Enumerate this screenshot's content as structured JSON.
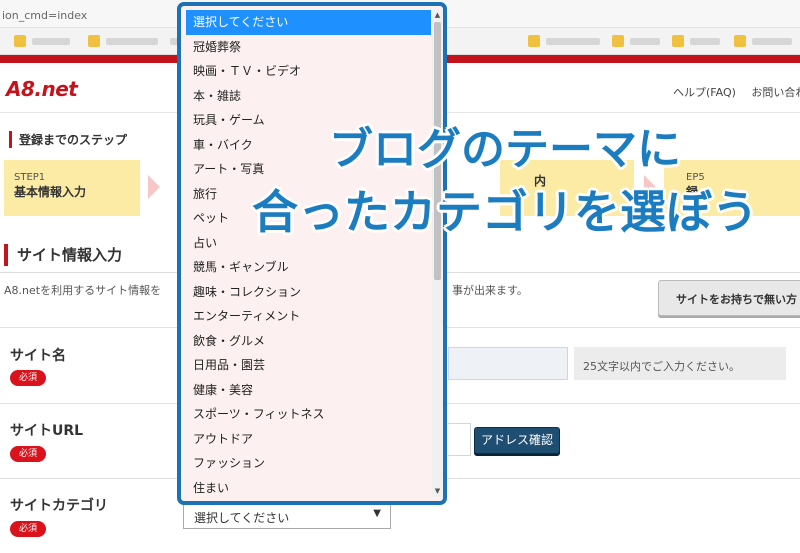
{
  "browser": {
    "url": "ion_cmd=index"
  },
  "header": {
    "logo": "A8.net",
    "links": [
      "ヘルプ(FAQ)",
      "お問い合わ"
    ]
  },
  "steps": {
    "title": "登録までのステップ",
    "items": [
      {
        "num": "STEP1",
        "label": "基本情報入力"
      },
      {
        "num": "",
        "label": ""
      },
      {
        "num": "",
        "label": "内"
      },
      {
        "num": "EP5",
        "label": "録"
      }
    ]
  },
  "section": {
    "title": "サイト情報入力",
    "intro_left": "A8.netを利用するサイト情報を",
    "intro_right": "事が出来ます。",
    "no_site_button": "サイトをお持ちで無い方"
  },
  "form": {
    "required_badge": "必須",
    "site_name_label": "サイト名",
    "site_name_hint": "25文字以内でご入力ください。",
    "site_url_label": "サイトURL",
    "address_check_button": "アドレス確認",
    "category_label": "サイトカテゴリ",
    "category_selected": "選択してください"
  },
  "dropdown": {
    "options": [
      "選択してください",
      "冠婚葬祭",
      "映画・ＴＶ・ビデオ",
      "本・雑誌",
      "玩具・ゲーム",
      "車・バイク",
      "アート・写真",
      "旅行",
      "ペット",
      "占い",
      "競馬・ギャンブル",
      "趣味・コレクション",
      "エンターティメント",
      "飲食・グルメ",
      "日用品・園芸",
      "健康・美容",
      "スポーツ・フィットネス",
      "アウトドア",
      "ファッション",
      "住まい"
    ],
    "selected_index": 0
  },
  "overlay": {
    "line1": "ブログのテーマに",
    "line2": "合ったカテゴリを選ぼう"
  },
  "colors": {
    "brand_red": "#c4141b",
    "overlay_blue": "#1c7cc0",
    "dropdown_border": "#1b72b5",
    "selected_option": "#1e90ff",
    "address_button": "#1f4e73"
  }
}
